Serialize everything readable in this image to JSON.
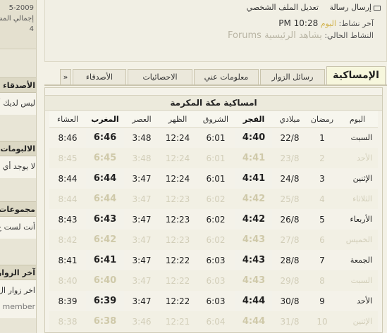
{
  "sidebar": {
    "top_lines": [
      "5-2009",
      "إجمالي المشار",
      "4"
    ],
    "blocks": [
      {
        "title": "الأصدقاء",
        "body": "ليس لديك أص"
      },
      {
        "title": "الالبومات",
        "body": "لا يوجد أي"
      },
      {
        "title": "مجموعات",
        "body": "أنت لست ع"
      },
      {
        "title": "آخر الزوار",
        "body": "اخر زوار ال",
        "extra": "member"
      }
    ]
  },
  "profile": {
    "send_message": "إرسال رسالة",
    "edit_profile": "تعديل الملف الشخصي",
    "last_activity_label": "آخر نشاط:",
    "last_activity_value": "اليوم",
    "last_activity_time": "10:28 PM",
    "current_activity_label": "النشاط الحالي:",
    "current_activity_value": "يشاهد الرئيسية Forums"
  },
  "tabs": {
    "items": [
      "الإمساكية",
      "رسائل الزوار",
      "معلومات عني",
      "الاحصائيات",
      "الأصدقاء"
    ],
    "more": "«"
  },
  "calendar": {
    "title": "امساكية مكة المكرمة",
    "headers": [
      "اليوم",
      "رمضان",
      "ميلادي",
      "الفجر",
      "الشروق",
      "الظهر",
      "العصر",
      "المغرب",
      "العشاء"
    ],
    "rows": [
      {
        "faded": false,
        "cells": [
          "السبت",
          "1",
          "22/8",
          "4:40",
          "6:01",
          "12:24",
          "3:48",
          "6:46",
          "8:46"
        ]
      },
      {
        "faded": true,
        "cells": [
          "الأحد",
          "2",
          "23/8",
          "4:41",
          "6:01",
          "12:24",
          "3:48",
          "6:45",
          "8:45"
        ]
      },
      {
        "faded": false,
        "cells": [
          "الإثنين",
          "3",
          "24/8",
          "4:41",
          "6:01",
          "12:24",
          "3:47",
          "6:44",
          "8:44"
        ]
      },
      {
        "faded": true,
        "cells": [
          "الثلاثاء",
          "4",
          "25/8",
          "4:42",
          "6:02",
          "12:23",
          "3:47",
          "6:44",
          "8:44"
        ]
      },
      {
        "faded": false,
        "cells": [
          "الأربعاء",
          "5",
          "26/8",
          "4:42",
          "6:02",
          "12:23",
          "3:47",
          "6:43",
          "8:43"
        ]
      },
      {
        "faded": true,
        "cells": [
          "الخميس",
          "6",
          "27/8",
          "4:43",
          "6:02",
          "12:23",
          "3:47",
          "6:42",
          "8:42"
        ]
      },
      {
        "faded": false,
        "cells": [
          "الجمعة",
          "7",
          "28/8",
          "4:43",
          "6:03",
          "12:22",
          "3:47",
          "6:41",
          "8:41"
        ]
      },
      {
        "faded": true,
        "cells": [
          "السبت",
          "8",
          "29/8",
          "4:43",
          "6:03",
          "12:22",
          "3:47",
          "6:40",
          "8:40"
        ]
      },
      {
        "faded": false,
        "cells": [
          "الأحد",
          "9",
          "30/8",
          "4:44",
          "6:03",
          "12:22",
          "3:47",
          "6:39",
          "8:39"
        ]
      },
      {
        "faded": true,
        "cells": [
          "الإثنين",
          "10",
          "31/8",
          "4:44",
          "6:04",
          "12:21",
          "3:46",
          "6:38",
          "8:38"
        ]
      }
    ]
  },
  "colors": {
    "background": "#f3f1e6",
    "active_tab": "#f7f7dd",
    "accent_text": "#d2b451"
  }
}
